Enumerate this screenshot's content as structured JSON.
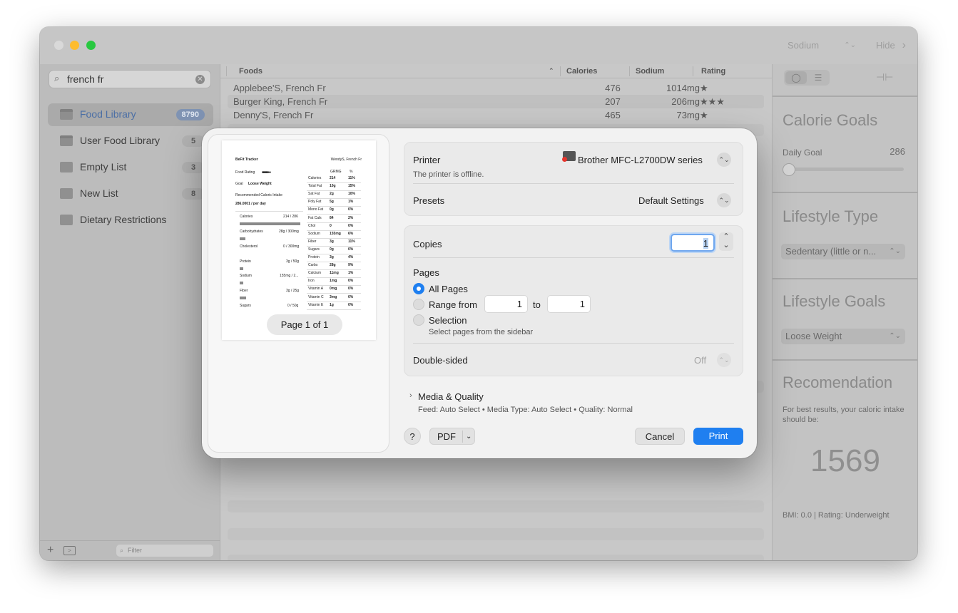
{
  "toolbar": {
    "sort_select": "Sodium",
    "hide_label": "Hide"
  },
  "sidebar": {
    "search_value": "french fr",
    "items": [
      {
        "label": "Food Library",
        "count": "8790"
      },
      {
        "label": "User Food Library",
        "count": "5"
      },
      {
        "label": "Empty List",
        "count": "3"
      },
      {
        "label": "New List",
        "count": "8"
      },
      {
        "label": "Dietary Restrictions",
        "count": ""
      }
    ],
    "filter_placeholder": "Filter"
  },
  "table": {
    "columns": [
      "Foods",
      "Calories",
      "Sodium",
      "Rating"
    ],
    "rows": [
      {
        "food": "Applebee'S, French Fr",
        "calories": "476",
        "sodium": "1014mg",
        "rating": "★"
      },
      {
        "food": "Burger King, French Fr",
        "calories": "207",
        "sodium": "206mg",
        "rating": "★★★"
      },
      {
        "food": "Denny'S, French Fr",
        "calories": "465",
        "sodium": "73mg",
        "rating": "★"
      }
    ]
  },
  "right_panel": {
    "calorie_goals_title": "Calorie Goals",
    "daily_goal_label": "Daily Goal",
    "daily_goal_value": "286",
    "daily_goal_fraction": 0.0,
    "lifestyle_type_title": "Lifestyle Type",
    "lifestyle_type_value": "Sedentary (little or n...",
    "lifestyle_goals_title": "Lifestyle Goals",
    "lifestyle_goals_value": "Loose Weight",
    "recommendation_title": "Recomendation",
    "recommendation_text": "For best results, your caloric intake should be:",
    "recommendation_value": "1569",
    "bmi_text": "BMI: 0.0 | Rating: Underweight"
  },
  "preview": {
    "app_name": "BeFit Tracker",
    "food_name": "WendyS, French Fr",
    "food_rating_label": "Food Rating",
    "goal_label": "Goal",
    "goal_value": "Loose Weight",
    "rec_label": "Recommended Caloric Intake",
    "rec_value": "286.0001 / per day",
    "left_rows": [
      {
        "name": "Calories",
        "value": "214 / 286"
      },
      {
        "name": "Carbohydrates",
        "value": "28g / 300mg"
      },
      {
        "name": "Cholesterol",
        "value": "0 / 300mg"
      },
      {
        "name": "Protein",
        "value": "3g / 50g"
      },
      {
        "name": "Sodium",
        "value": "155mg / 2..."
      },
      {
        "name": "Fiber",
        "value": "3g / 25g"
      },
      {
        "name": "Sugars",
        "value": "0 / 50g"
      }
    ],
    "table_headers": [
      "GRMG",
      "%"
    ],
    "table_rows": [
      [
        "Calories",
        "214",
        "11%"
      ],
      [
        "Total Fat",
        "10g",
        "15%"
      ],
      [
        "Sat Fat",
        "2g",
        "10%"
      ],
      [
        "Poly Fat",
        "5g",
        "1%"
      ],
      [
        "Mono Fat",
        "0g",
        "0%"
      ],
      [
        "Fat Cals",
        "84",
        "2%"
      ],
      [
        "Chol",
        "0",
        "0%"
      ],
      [
        "Sodium",
        "155mg",
        "6%"
      ],
      [
        "Fiber",
        "3g",
        "11%"
      ],
      [
        "Sugars",
        "0g",
        "0%"
      ],
      [
        "Protein",
        "3g",
        "4%"
      ],
      [
        "Carbs",
        "28g",
        "9%"
      ],
      [
        "Calcium",
        "11mg",
        "1%"
      ],
      [
        "Iron",
        "1mg",
        "0%"
      ],
      [
        "Vitamin A",
        "0mg",
        "0%"
      ],
      [
        "Vitamin C",
        "3mg",
        "0%"
      ],
      [
        "Vitamin E",
        "1g",
        "0%"
      ]
    ],
    "page_indicator": "Page 1 of 1"
  },
  "print": {
    "printer_label": "Printer",
    "printer_value": "Brother MFC-L2700DW series",
    "printer_status": "The printer is offline.",
    "presets_label": "Presets",
    "presets_value": "Default Settings",
    "copies_label": "Copies",
    "copies_value": "1",
    "pages_label": "Pages",
    "all_pages": "All Pages",
    "range_from": "Range from",
    "range_start": "1",
    "range_to": "to",
    "range_end": "1",
    "selection": "Selection",
    "selection_hint": "Select pages from the sidebar",
    "double_sided_label": "Double-sided",
    "double_sided_value": "Off",
    "media_quality": "Media & Quality",
    "media_summary": "Feed: Auto Select • Media Type: Auto Select • Quality: Normal",
    "help": "?",
    "pdf": "PDF",
    "cancel": "Cancel",
    "print": "Print"
  },
  "colors": {
    "accent": "#1f7ff0",
    "close": "#d9d9d9",
    "minimize": "#febc2e",
    "maximize": "#28c840"
  }
}
